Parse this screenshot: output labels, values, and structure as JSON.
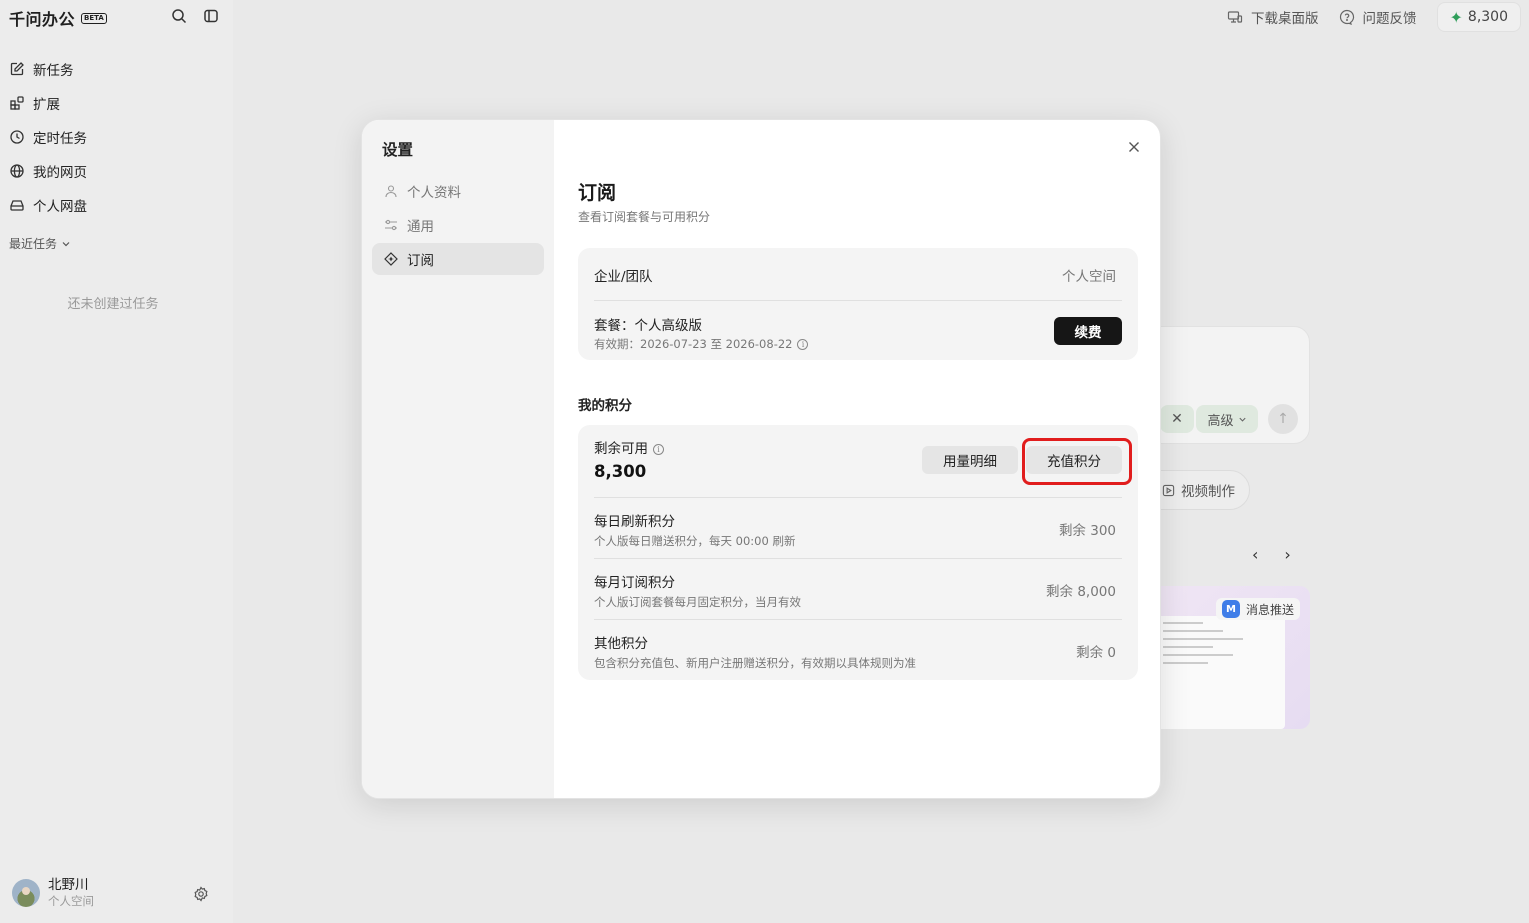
{
  "sidebar": {
    "brand": "千问办公",
    "beta": "BETA",
    "nav": [
      {
        "label": "新任务",
        "icon": "edit-icon"
      },
      {
        "label": "扩展",
        "icon": "extensions-icon"
      },
      {
        "label": "定时任务",
        "icon": "clock-icon"
      },
      {
        "label": "我的网页",
        "icon": "globe-icon"
      },
      {
        "label": "个人网盘",
        "icon": "drive-icon"
      }
    ],
    "recent_label": "最近任务",
    "empty_text": "还未创建过任务",
    "user": {
      "name": "北野川",
      "sub": "个人空间"
    }
  },
  "topbar": {
    "download": "下载桌面版",
    "feedback": "问题反馈",
    "credits": "8,300"
  },
  "background": {
    "chip_level": "高级",
    "video_btn": "视频制作",
    "message_push": "消息推送",
    "m_badge": "M"
  },
  "modal": {
    "title": "设置",
    "menu": [
      {
        "label": "个人资料",
        "icon": "user-icon"
      },
      {
        "label": "通用",
        "icon": "sliders-icon"
      },
      {
        "label": "订阅",
        "icon": "subscription-icon",
        "active": true
      }
    ],
    "heading": "订阅",
    "description": "查看订阅套餐与可用积分",
    "plan": {
      "org_label": "企业/团队",
      "org_value": "个人空间",
      "plan_label": "套餐：个人高级版",
      "validity": "有效期：2026-07-23 至 2026-08-22",
      "renew": "续费"
    },
    "credits_title": "我的积分",
    "credits": {
      "remaining_label": "剩余可用",
      "remaining_value": "8,300",
      "usage_btn": "用量明细",
      "recharge_btn": "充值积分",
      "rows": [
        {
          "title": "每日刷新积分",
          "sub": "个人版每日赠送积分，每天 00:00 刷新",
          "value": "剩余 300"
        },
        {
          "title": "每月订阅积分",
          "sub": "个人版订阅套餐每月固定积分，当月有效",
          "value": "剩余 8,000"
        },
        {
          "title": "其他积分",
          "sub": "包含积分充值包、新用户注册赠送积分，有效期以具体规则为准",
          "value": "剩余 0"
        }
      ]
    }
  }
}
